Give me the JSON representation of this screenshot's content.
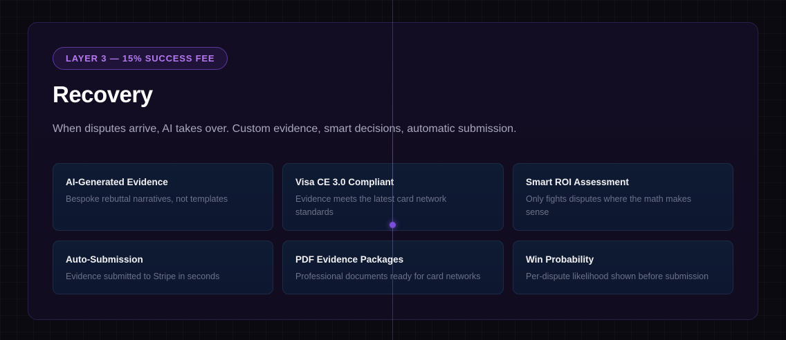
{
  "section": {
    "badge": "LAYER 3 — 15% SUCCESS FEE",
    "title": "Recovery",
    "subtitle": "When disputes arrive, AI takes over. Custom evidence, smart decisions, automatic submission."
  },
  "features": [
    {
      "title": "AI-Generated Evidence",
      "description": "Bespoke rebuttal narratives, not templates"
    },
    {
      "title": "Visa CE 3.0 Compliant",
      "description": "Evidence meets the latest card network standards"
    },
    {
      "title": "Smart ROI Assessment",
      "description": "Only fights disputes where the math makes sense"
    },
    {
      "title": "Auto-Submission",
      "description": "Evidence submitted to Stripe in seconds"
    },
    {
      "title": "PDF Evidence Packages",
      "description": "Professional documents ready for card networks"
    },
    {
      "title": "Win Probability",
      "description": "Per-dispute likelihood shown before submission"
    }
  ],
  "colors": {
    "accent": "#b479f0",
    "background": "#0a0a10",
    "panel": "#120d22",
    "card": "#0f1a33"
  }
}
